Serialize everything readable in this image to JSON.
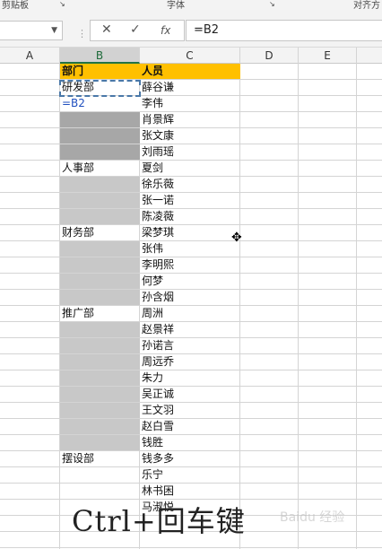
{
  "ribbon": {
    "label_left": "剪贴板",
    "label_mid": "字体",
    "label_right": "对齐方"
  },
  "formula_bar": {
    "cancel_icon": "✕",
    "enter_icon": "✓",
    "fx_label": "fx",
    "formula": "=B2"
  },
  "columns": [
    "A",
    "B",
    "C",
    "D",
    "E"
  ],
  "selected_column": "B",
  "header": {
    "b": "部门",
    "c": "人员"
  },
  "rows": [
    {
      "b": "研发部",
      "c": "薛谷谦",
      "b_style": "dashed"
    },
    {
      "b": "=B2",
      "c": "李伟",
      "b_style": "edit"
    },
    {
      "b": "",
      "c": "肖景辉",
      "b_style": "dark"
    },
    {
      "b": "",
      "c": "张文康",
      "b_style": "dark"
    },
    {
      "b": "",
      "c": "刘雨瑶",
      "b_style": "dark"
    },
    {
      "b": "人事部",
      "c": "夏剑",
      "b_style": ""
    },
    {
      "b": "",
      "c": "徐乐薇",
      "b_style": "gray"
    },
    {
      "b": "",
      "c": "张一诺",
      "b_style": "gray"
    },
    {
      "b": "",
      "c": "陈凌薇",
      "b_style": "gray"
    },
    {
      "b": "财务部",
      "c": "梁梦琪",
      "b_style": ""
    },
    {
      "b": "",
      "c": "张伟",
      "b_style": "gray"
    },
    {
      "b": "",
      "c": "李明熙",
      "b_style": "gray"
    },
    {
      "b": "",
      "c": "何梦",
      "b_style": "gray"
    },
    {
      "b": "",
      "c": "孙含烟",
      "b_style": "gray"
    },
    {
      "b": "推广部",
      "c": "周洲",
      "b_style": ""
    },
    {
      "b": "",
      "c": "赵景祥",
      "b_style": "gray"
    },
    {
      "b": "",
      "c": "孙诺言",
      "b_style": "gray"
    },
    {
      "b": "",
      "c": "周远乔",
      "b_style": "gray"
    },
    {
      "b": "",
      "c": "朱力",
      "b_style": "gray"
    },
    {
      "b": "",
      "c": "吴正诚",
      "b_style": "gray"
    },
    {
      "b": "",
      "c": "王文羽",
      "b_style": "gray"
    },
    {
      "b": "",
      "c": "赵白雪",
      "b_style": "gray"
    },
    {
      "b": "",
      "c": "钱胜",
      "b_style": "gray"
    },
    {
      "b": "摆设部",
      "c": "钱多多",
      "b_style": ""
    },
    {
      "b": "",
      "c": "乐宁",
      "b_style": ""
    },
    {
      "b": "",
      "c": "林书困",
      "b_style": ""
    },
    {
      "b": "",
      "c": "马淑悦",
      "b_style": ""
    }
  ],
  "overlay_caption": "Ctrl+回车键",
  "watermark": "Baidu 经验",
  "colors": {
    "header_fill": "#ffc000",
    "gray_fill": "#c8c8c8",
    "dark_fill": "#a7a7a7",
    "accent": "#217346"
  }
}
